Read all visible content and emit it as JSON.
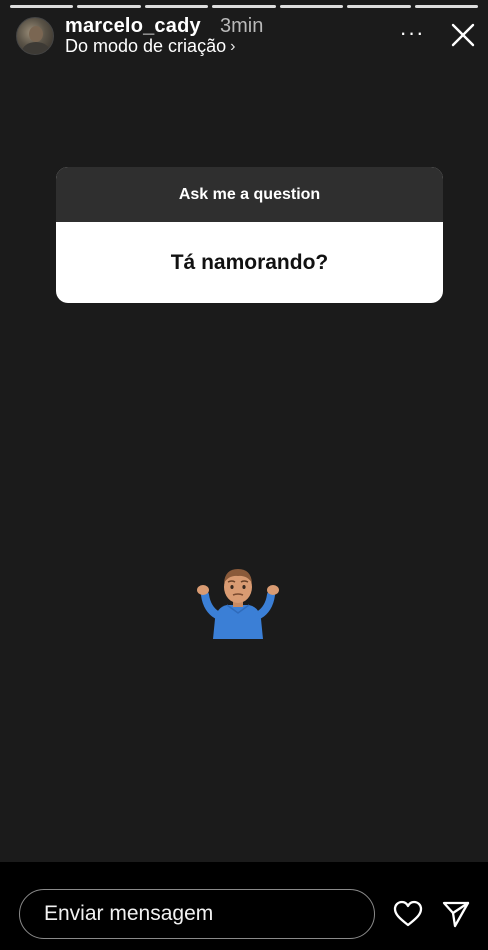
{
  "story": {
    "progress_segments": 7,
    "username": "marcelo_cady",
    "timestamp": "3min",
    "subtitle": "Do modo de criação",
    "subtitle_chevron": "›",
    "more_icon": "more-horizontal-icon",
    "more_glyph": "···",
    "close_icon": "close-icon",
    "background_color": "#1b1b1b"
  },
  "question_sticker": {
    "prompt": "Ask me a question",
    "question": "Tá namorando?"
  },
  "sticker_emoji": {
    "icon": "person-shrugging-emoji"
  },
  "footer": {
    "message_placeholder": "Enviar mensagem",
    "like_icon": "heart-icon",
    "send_icon": "send-icon"
  }
}
